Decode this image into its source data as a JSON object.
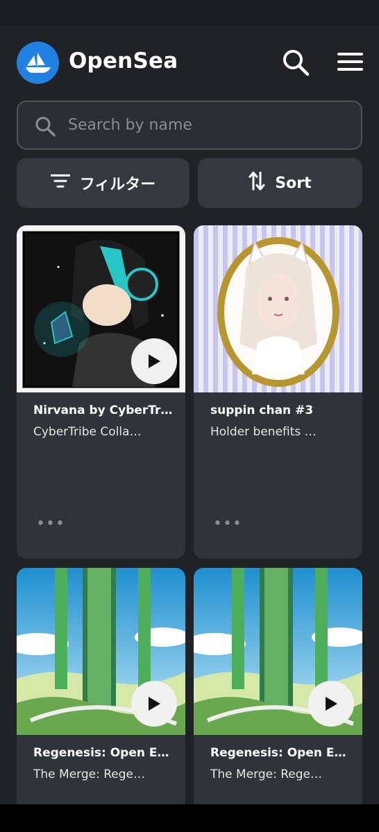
{
  "header": {
    "brand": "OpenSea",
    "logo_icon": "opensea-ship-icon",
    "search_icon": "search-icon",
    "menu_icon": "hamburger-menu-icon"
  },
  "search": {
    "placeholder": "Search by name",
    "icon": "search-icon"
  },
  "controls": {
    "filter_label": "フィルター",
    "filter_icon": "filter-lines-icon",
    "sort_label": "Sort",
    "sort_icon": "sort-arrows-icon"
  },
  "cards": [
    {
      "title": "Nirvana by CyberTri…",
      "subtitle": "CyberTribe Colla…",
      "has_video": true,
      "more": "•••"
    },
    {
      "title": "suppin chan #3",
      "subtitle": "Holder benefits …",
      "has_video": false,
      "more": "•••"
    },
    {
      "title": "Regenesis: Open Edit…",
      "subtitle": "The Merge: Rege…",
      "has_video": true
    },
    {
      "title": "Regenesis: Open Edit…",
      "subtitle": "The Merge: Rege…",
      "has_video": true
    }
  ],
  "colors": {
    "background": "#202225",
    "card": "#303339",
    "accent": "#2081e2"
  }
}
